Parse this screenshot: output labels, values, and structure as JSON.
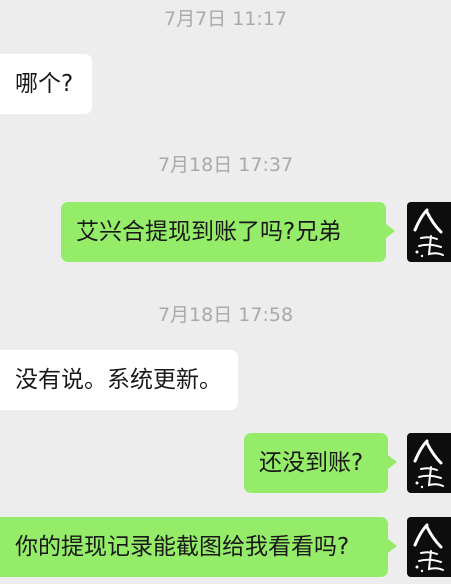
{
  "timestamps": [
    "7月7日 11:17",
    "7月18日 17:37",
    "7月18日 17:58"
  ],
  "messages": [
    {
      "side": "left",
      "text": "哪个?"
    },
    {
      "side": "right",
      "text": "艾兴合提现到账了吗?兄弟"
    },
    {
      "side": "left",
      "text": "没有说。系统更新。"
    },
    {
      "side": "right",
      "text": "还没到账?"
    },
    {
      "side": "right",
      "text": "你的提现记录能截图给我看看吗?"
    }
  ],
  "avatar": {
    "icon": "calligraphy-avatar-icon"
  },
  "colors": {
    "background": "#ededed",
    "incoming_bubble": "#ffffff",
    "outgoing_bubble": "#95ec69",
    "timestamp": "#a9a9a9",
    "avatar_background": "#0d0d0d"
  }
}
